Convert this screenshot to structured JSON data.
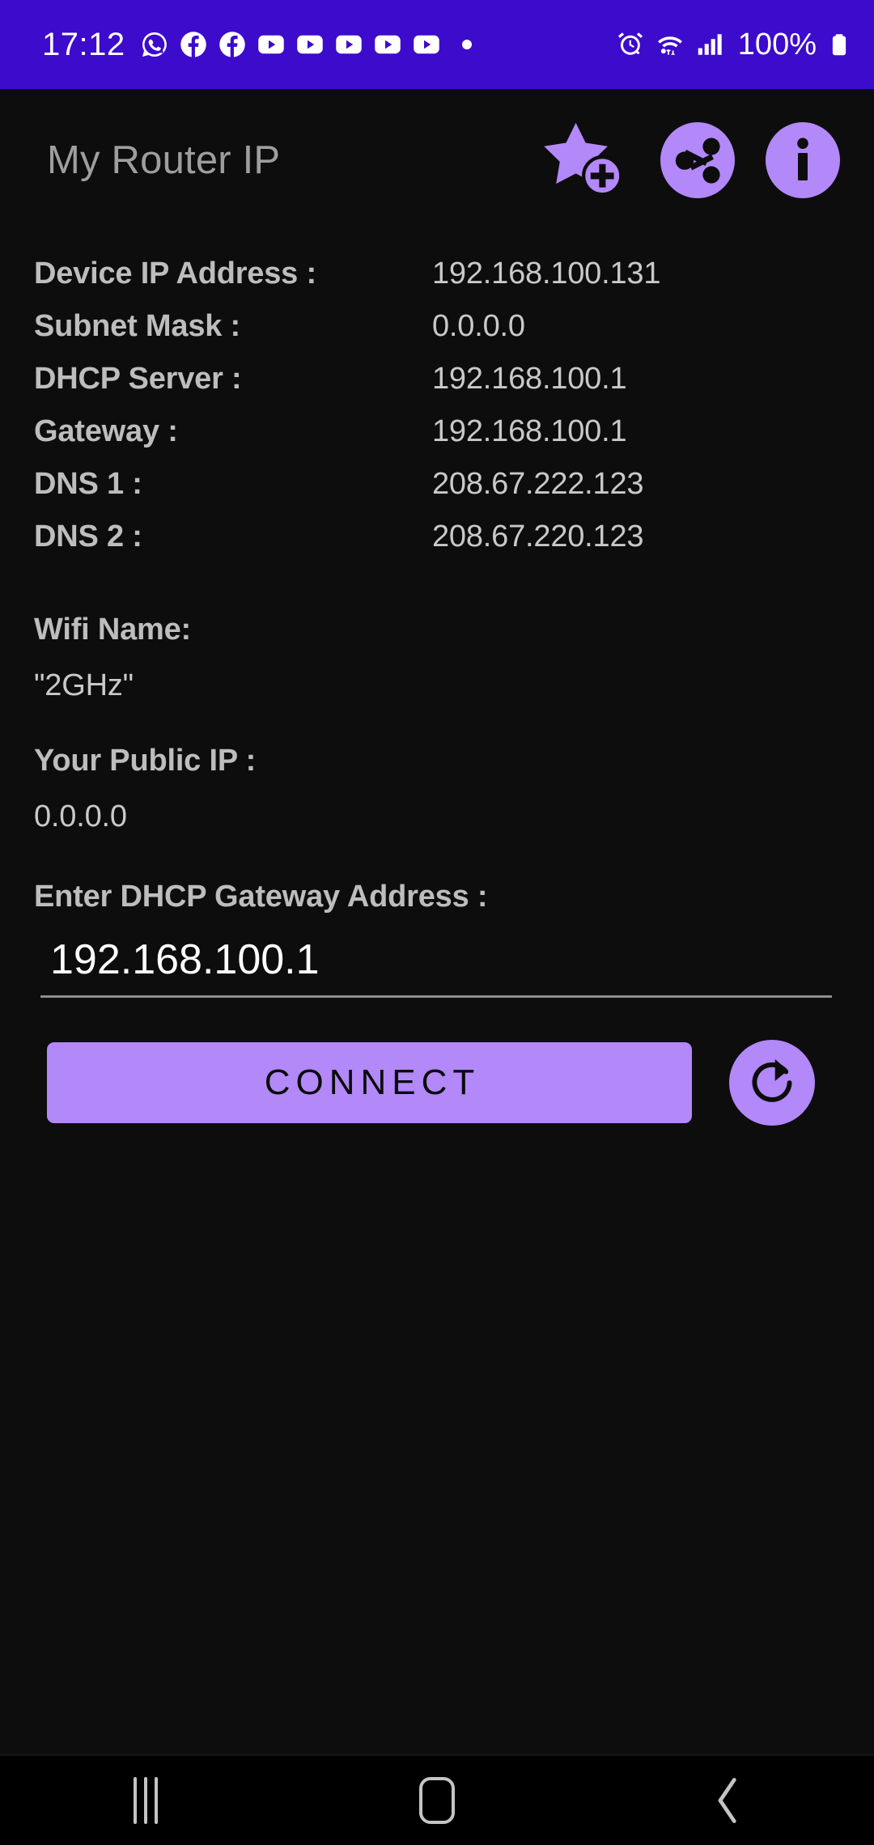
{
  "statusbar": {
    "time": "17:12",
    "notification_icons": [
      "whatsapp-icon",
      "facebook-icon",
      "facebook-icon",
      "youtube-icon",
      "youtube-icon",
      "youtube-icon",
      "youtube-icon",
      "youtube-icon",
      "more-notifications-dot"
    ],
    "status_icons": [
      "alarm-icon",
      "wifi-icon",
      "signal-icon"
    ],
    "battery_percent": "100%",
    "background_color": "#3d0bcc"
  },
  "header": {
    "title": "My Router IP",
    "actions": [
      {
        "name": "add-favorite-button",
        "icon": "star-plus-icon"
      },
      {
        "name": "share-button",
        "icon": "share-icon"
      },
      {
        "name": "info-button",
        "icon": "info-icon"
      }
    ],
    "accent_color": "#b388f9"
  },
  "network_info": [
    {
      "label": "Device IP Address :",
      "value": "192.168.100.131"
    },
    {
      "label": "Subnet Mask :",
      "value": "0.0.0.0"
    },
    {
      "label": "DHCP Server :",
      "value": "192.168.100.1"
    },
    {
      "label": "Gateway :",
      "value": "192.168.100.1"
    },
    {
      "label": "DNS 1 :",
      "value": "208.67.222.123"
    },
    {
      "label": "DNS 2 :",
      "value": "208.67.220.123"
    }
  ],
  "wifi": {
    "label": "Wifi Name:",
    "value": "\"2GHz\""
  },
  "public_ip": {
    "label": "Your Public IP :",
    "value": "0.0.0.0"
  },
  "gateway_field": {
    "label": "Enter DHCP Gateway Address :",
    "value": "192.168.100.1",
    "placeholder": "192.168.100.1"
  },
  "actions": {
    "connect_label": "CONNECT",
    "refresh_icon": "refresh-icon"
  },
  "navbar": {
    "recents": "recents-icon",
    "home": "home-icon",
    "back": "back-icon"
  }
}
